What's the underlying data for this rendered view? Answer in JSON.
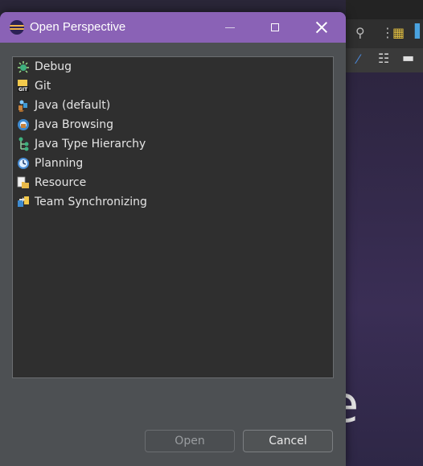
{
  "dialog": {
    "title": "Open Perspective",
    "window_controls": {
      "minimize": "minimize-icon",
      "maximize": "maximize-icon",
      "close": "close-icon"
    }
  },
  "perspectives": [
    {
      "label": "Debug",
      "icon": "debug-icon"
    },
    {
      "label": "Git",
      "icon": "git-icon"
    },
    {
      "label": "Java (default)",
      "icon": "java-icon"
    },
    {
      "label": "Java Browsing",
      "icon": "java-browsing-icon"
    },
    {
      "label": "Java Type Hierarchy",
      "icon": "type-hierarchy-icon"
    },
    {
      "label": "Planning",
      "icon": "planning-icon"
    },
    {
      "label": "Resource",
      "icon": "resource-icon"
    },
    {
      "label": "Team Synchronizing",
      "icon": "team-sync-icon"
    }
  ],
  "buttons": {
    "open_label": "Open",
    "cancel_label": "Cancel"
  },
  "background": {
    "partial_text": "e"
  },
  "colors": {
    "titlebar": "#8a62b6",
    "dialog_bg": "#4d5053",
    "list_bg": "#2f2f2f"
  }
}
